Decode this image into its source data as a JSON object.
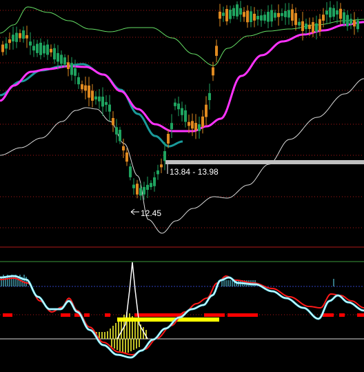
{
  "chart_data": {
    "type": "line",
    "title": "",
    "panes": [
      {
        "name": "price",
        "chart_kind": "candlestick with moving averages and envelope bands",
        "annotations": [
          {
            "text": "13.84 - 13.98",
            "kind": "price-range-bar"
          },
          {
            "text": "12.45",
            "kind": "low-marker"
          }
        ],
        "series": [
          {
            "color": "#66e066",
            "role": "upper-band"
          },
          {
            "color": "#ff33ff",
            "role": "long-moving-average"
          },
          {
            "color": "#1a9a9a",
            "role": "moving-average"
          },
          {
            "color": "#dddddd",
            "role": "lower-band"
          }
        ],
        "candle_colors": {
          "up": "#e08a20",
          "down": "#1fa35f"
        },
        "grid": "dotted-red"
      },
      {
        "name": "oscillator",
        "chart_kind": "macd-style oscillator",
        "series": [
          {
            "color": "#66e8ff",
            "role": "fast-line"
          },
          {
            "color": "#ff1a1a",
            "role": "slow-line"
          },
          {
            "color": "#ffffff",
            "role": "spike-histogram"
          },
          {
            "color": "#ffff00",
            "role": "signal-bar"
          }
        ],
        "signal_dots_color": "#ff0000"
      }
    ],
    "colors": {
      "background": "#000000",
      "grid": "#b01818",
      "range_bar": "#c0c0c0",
      "label": "#ffffff",
      "osc_top_line": "#3a9a3a",
      "osc_mid_line": "#3040c0",
      "osc_zero_line": "#dddddd"
    }
  }
}
